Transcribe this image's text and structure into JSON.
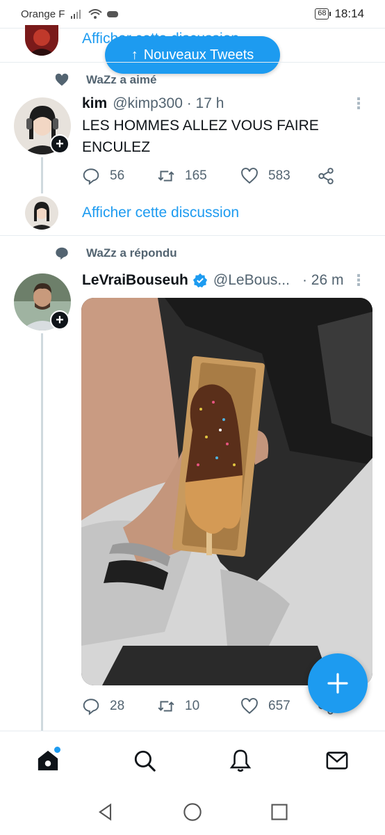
{
  "status_bar": {
    "carrier": "Orange F",
    "battery": "68",
    "time": "18:14"
  },
  "top_row": {
    "link": "Afficher cette discussion"
  },
  "new_tweets_pill": {
    "arrow": "↑",
    "label": "Nouveaux Tweets"
  },
  "tweet1": {
    "social_context": "WaZz a aimé",
    "social_icon": "heart-icon",
    "name": "kim",
    "handle": "@kimp300 · 17 h",
    "text": "LES HOMMES ALLEZ VOUS FAIRE ENCULEZ",
    "replies": "56",
    "retweets": "165",
    "likes": "583",
    "show_thread": "Afficher cette discussion"
  },
  "tweet2": {
    "social_context": "WaZz a répondu",
    "social_icon": "reply-bubble-icon",
    "name": "LeVraiBouseuh",
    "verified": true,
    "handle": "@LeBous...",
    "time": "· 26 m",
    "replies": "28",
    "retweets": "10",
    "likes": "657"
  },
  "bottom_nav": {
    "items": [
      "home-icon",
      "search-icon",
      "notifications-icon",
      "messages-icon"
    ]
  },
  "colors": {
    "accent": "#1d9bf0",
    "text_primary": "#0f1419",
    "text_secondary": "#536471"
  }
}
